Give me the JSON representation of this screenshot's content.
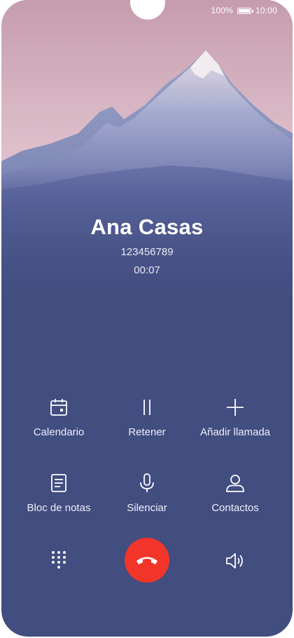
{
  "status_bar": {
    "battery": "100%",
    "time": "10:00",
    "battery_level": 1.0
  },
  "call": {
    "name": "Ana Casas",
    "number": "123456789",
    "duration": "00:07"
  },
  "actions": [
    {
      "label": "Calendario",
      "icon": "calendar-icon"
    },
    {
      "label": "Retener",
      "icon": "pause-icon"
    },
    {
      "label": "Añadir llamada",
      "icon": "plus-icon"
    },
    {
      "label": "Bloc de notas",
      "icon": "notepad-icon"
    },
    {
      "label": "Silenciar",
      "icon": "microphone-icon"
    },
    {
      "label": "Contactos",
      "icon": "contact-icon"
    }
  ],
  "bottom": {
    "keypad_icon": "dialpad-icon",
    "end_call_icon": "hang-up-icon",
    "speaker_icon": "speaker-icon"
  },
  "colors": {
    "background": "#424d80",
    "end_call": "#f2352b",
    "sky_top": "#c6a0b2"
  }
}
